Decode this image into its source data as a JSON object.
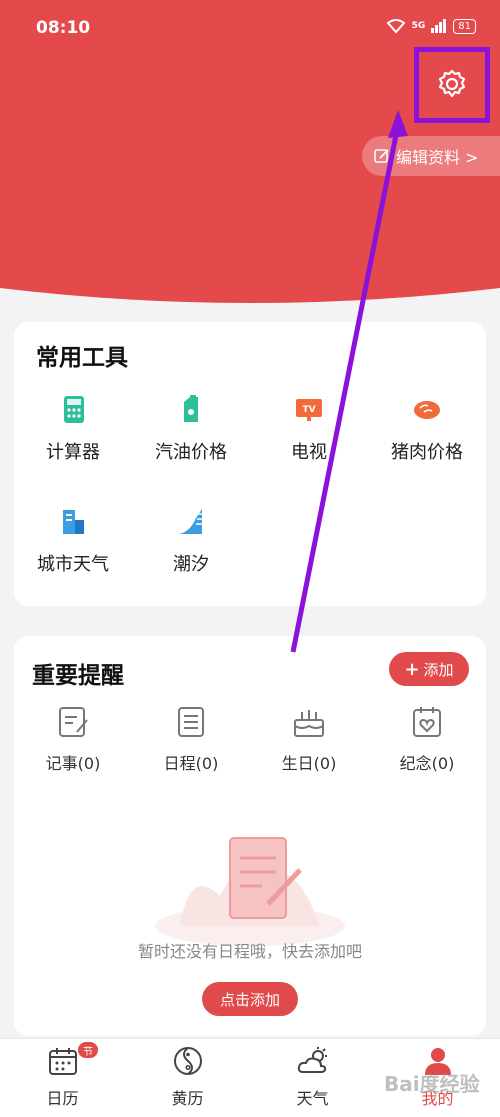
{
  "status_bar": {
    "time": "08:10",
    "network": "5G",
    "battery": "81"
  },
  "header": {
    "edit_profile_label": "编辑资料 >"
  },
  "tools": {
    "title": "常用工具",
    "items": [
      {
        "label": "计算器",
        "icon": "calculator-icon"
      },
      {
        "label": "汽油价格",
        "icon": "gas-can-icon"
      },
      {
        "label": "电视",
        "icon": "tv-icon"
      },
      {
        "label": "猪肉价格",
        "icon": "meat-icon"
      },
      {
        "label": "城市天气",
        "icon": "city-building-icon"
      },
      {
        "label": "潮汐",
        "icon": "tide-icon"
      }
    ]
  },
  "reminders": {
    "title": "重要提醒",
    "add_label": "添加",
    "items": [
      {
        "label": "记事(0)",
        "icon": "note-icon"
      },
      {
        "label": "日程(0)",
        "icon": "schedule-icon"
      },
      {
        "label": "生日(0)",
        "icon": "birthday-cake-icon"
      },
      {
        "label": "纪念(0)",
        "icon": "anniversary-icon"
      }
    ],
    "empty_text": "暂时还没有日程哦，快去添加吧",
    "click_add_label": "点击添加"
  },
  "tab_bar": {
    "items": [
      {
        "label": "日历",
        "icon": "calendar-icon",
        "badge": "节"
      },
      {
        "label": "黄历",
        "icon": "yin-yang-icon"
      },
      {
        "label": "天气",
        "icon": "weather-icon"
      },
      {
        "label": "我的",
        "icon": "user-icon",
        "active": true
      }
    ]
  },
  "watermark": "Bai度经验",
  "colors": {
    "header_red": "#e4494c",
    "accent_red": "#e04a4a",
    "highlight_purple": "#8b12d9",
    "tool_icon_color": "#3b9ee3"
  }
}
